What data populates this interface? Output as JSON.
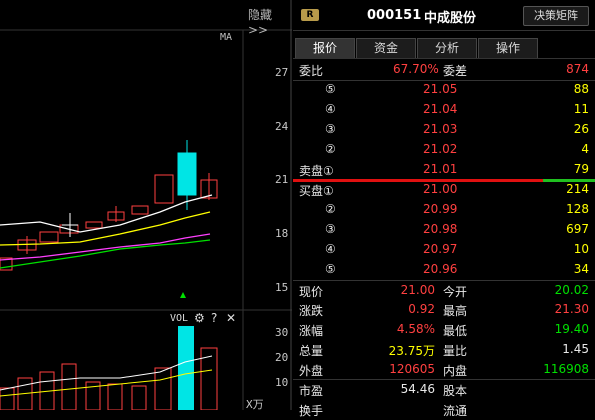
{
  "chart": {
    "hide_label": "隐藏>>",
    "ma_label": "MA",
    "price_ticks": [
      "27",
      "24",
      "21",
      "18",
      "15"
    ],
    "vol_label": "VOL",
    "vol_icons": [
      "gear-icon",
      "help-icon",
      "close-icon"
    ],
    "vol_ticks": [
      "30",
      "20",
      "10"
    ],
    "vol_unit": "X万"
  },
  "header": {
    "badge": "R",
    "code": "000151",
    "name": "中成股份",
    "decide_button": "决策矩阵"
  },
  "tabs": [
    "报价",
    "资金",
    "分析",
    "操作"
  ],
  "active_tab": "报价",
  "quote": {
    "weibi_label": "委比",
    "weibi_value": "67.70%",
    "weicha_label": "委差",
    "weicha_value": "874",
    "sell": [
      {
        "label": "⑤",
        "price": "21.05",
        "vol": "88"
      },
      {
        "label": "④",
        "price": "21.04",
        "vol": "11"
      },
      {
        "label": "③",
        "price": "21.03",
        "vol": "26"
      },
      {
        "label": "②",
        "price": "21.02",
        "vol": "4"
      },
      {
        "label": "卖盘①",
        "price": "21.01",
        "vol": "79"
      }
    ],
    "buy": [
      {
        "label": "买盘①",
        "price": "21.00",
        "vol": "214"
      },
      {
        "label": "②",
        "price": "20.99",
        "vol": "128"
      },
      {
        "label": "③",
        "price": "20.98",
        "vol": "697"
      },
      {
        "label": "④",
        "price": "20.97",
        "vol": "10"
      },
      {
        "label": "⑤",
        "price": "20.96",
        "vol": "34"
      }
    ],
    "stats": [
      {
        "l1": "现价",
        "v1": "21.00",
        "l2": "今开",
        "v2": "20.02"
      },
      {
        "l1": "涨跌",
        "v1": "0.92",
        "l2": "最高",
        "v2": "21.30"
      },
      {
        "l1": "涨幅",
        "v1": "4.58%",
        "l2": "最低",
        "v2": "19.40"
      },
      {
        "l1": "总量",
        "v1": "23.75万",
        "l2": "量比",
        "v2": "1.45"
      },
      {
        "l1": "外盘",
        "v1": "120605",
        "l2": "内盘",
        "v2": "116908"
      },
      {
        "l1": "市盈",
        "v1": "54.46",
        "l2": "股本",
        "v2": ""
      },
      {
        "l1": "换手",
        "v1": "",
        "l2": "流通",
        "v2": ""
      }
    ]
  },
  "colors": {
    "up": "#ff4040",
    "down": "#00e000",
    "neutral": "#e8e8e8",
    "volume_highlight": "#00e5e5"
  }
}
